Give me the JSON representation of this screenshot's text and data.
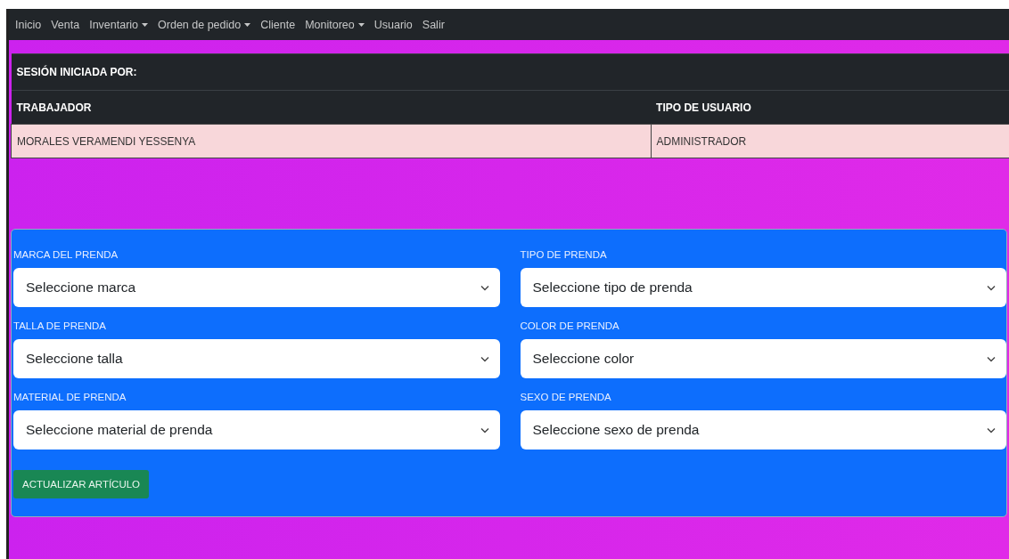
{
  "navbar": {
    "items": [
      {
        "label": "Inicio",
        "kind": "link"
      },
      {
        "label": "Venta",
        "kind": "link"
      },
      {
        "label": "Inventario",
        "kind": "dropdown"
      },
      {
        "label": "Orden de pedido",
        "kind": "dropdown"
      },
      {
        "label": "Cliente",
        "kind": "link"
      },
      {
        "label": "Monitoreo",
        "kind": "dropdown"
      },
      {
        "label": "Usuario",
        "kind": "link"
      },
      {
        "label": "Salir",
        "kind": "link"
      }
    ]
  },
  "session_table": {
    "title": "SESIÓN INICIADA POR:",
    "columns": [
      "TRABAJADOR",
      "TIPO DE USUARIO"
    ],
    "rows": [
      [
        "MORALES VERAMENDI YESSENYA",
        "ADMINISTRADOR"
      ]
    ]
  },
  "form": {
    "fields": [
      {
        "label": "MARCA DEL PRENDA",
        "placeholder": "Seleccione marca"
      },
      {
        "label": "TIPO DE PRENDA",
        "placeholder": "Seleccione tipo de prenda"
      },
      {
        "label": "TALLA DE PRENDA",
        "placeholder": "Seleccione talla"
      },
      {
        "label": "COLOR DE PRENDA",
        "placeholder": "Seleccione color"
      },
      {
        "label": "MATERIAL DE PRENDA",
        "placeholder": "Seleccione material de prenda"
      },
      {
        "label": "SEXO DE PRENDA",
        "placeholder": "Seleccione sexo de prenda"
      }
    ],
    "submit_button": "ACTUALIZAR ARTÍCULO"
  }
}
